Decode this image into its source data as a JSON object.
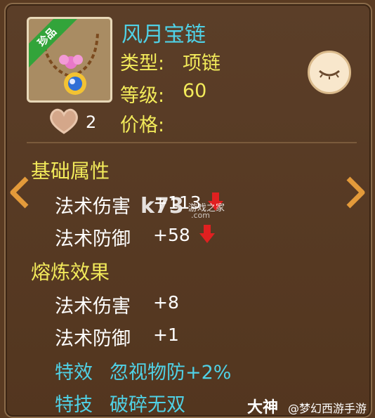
{
  "item": {
    "badge": "珍品",
    "name": "风月宝链",
    "type_label": "类型:",
    "type_value": "项链",
    "level_label": "等级:",
    "level_value": "60",
    "price_label": "价格:",
    "like_count": "2"
  },
  "basic": {
    "title": "基础属性",
    "attrs": [
      {
        "name": "法术伤害",
        "value": "+113"
      },
      {
        "name": "法术防御",
        "value": "+58"
      }
    ]
  },
  "smelt": {
    "title": "熔炼效果",
    "attrs": [
      {
        "name": "法术伤害",
        "value": "+8"
      },
      {
        "name": "法术防御",
        "value": "+1"
      }
    ]
  },
  "special": {
    "effect_label": "特效",
    "effect_value": "忽视物防+2%",
    "skill_label": "特技",
    "skill_value": "破碎无双"
  },
  "watermark": {
    "logo": "k73",
    "site": "游戏之家",
    "url": ".com"
  },
  "footer": {
    "brand": "大神",
    "account": "@梦幻西游手游"
  },
  "colors": {
    "panel_bg": "#5b3e28",
    "name_cyan": "#4fd1e6",
    "label_yellow": "#f2ea5a",
    "down_red": "#e02020"
  }
}
